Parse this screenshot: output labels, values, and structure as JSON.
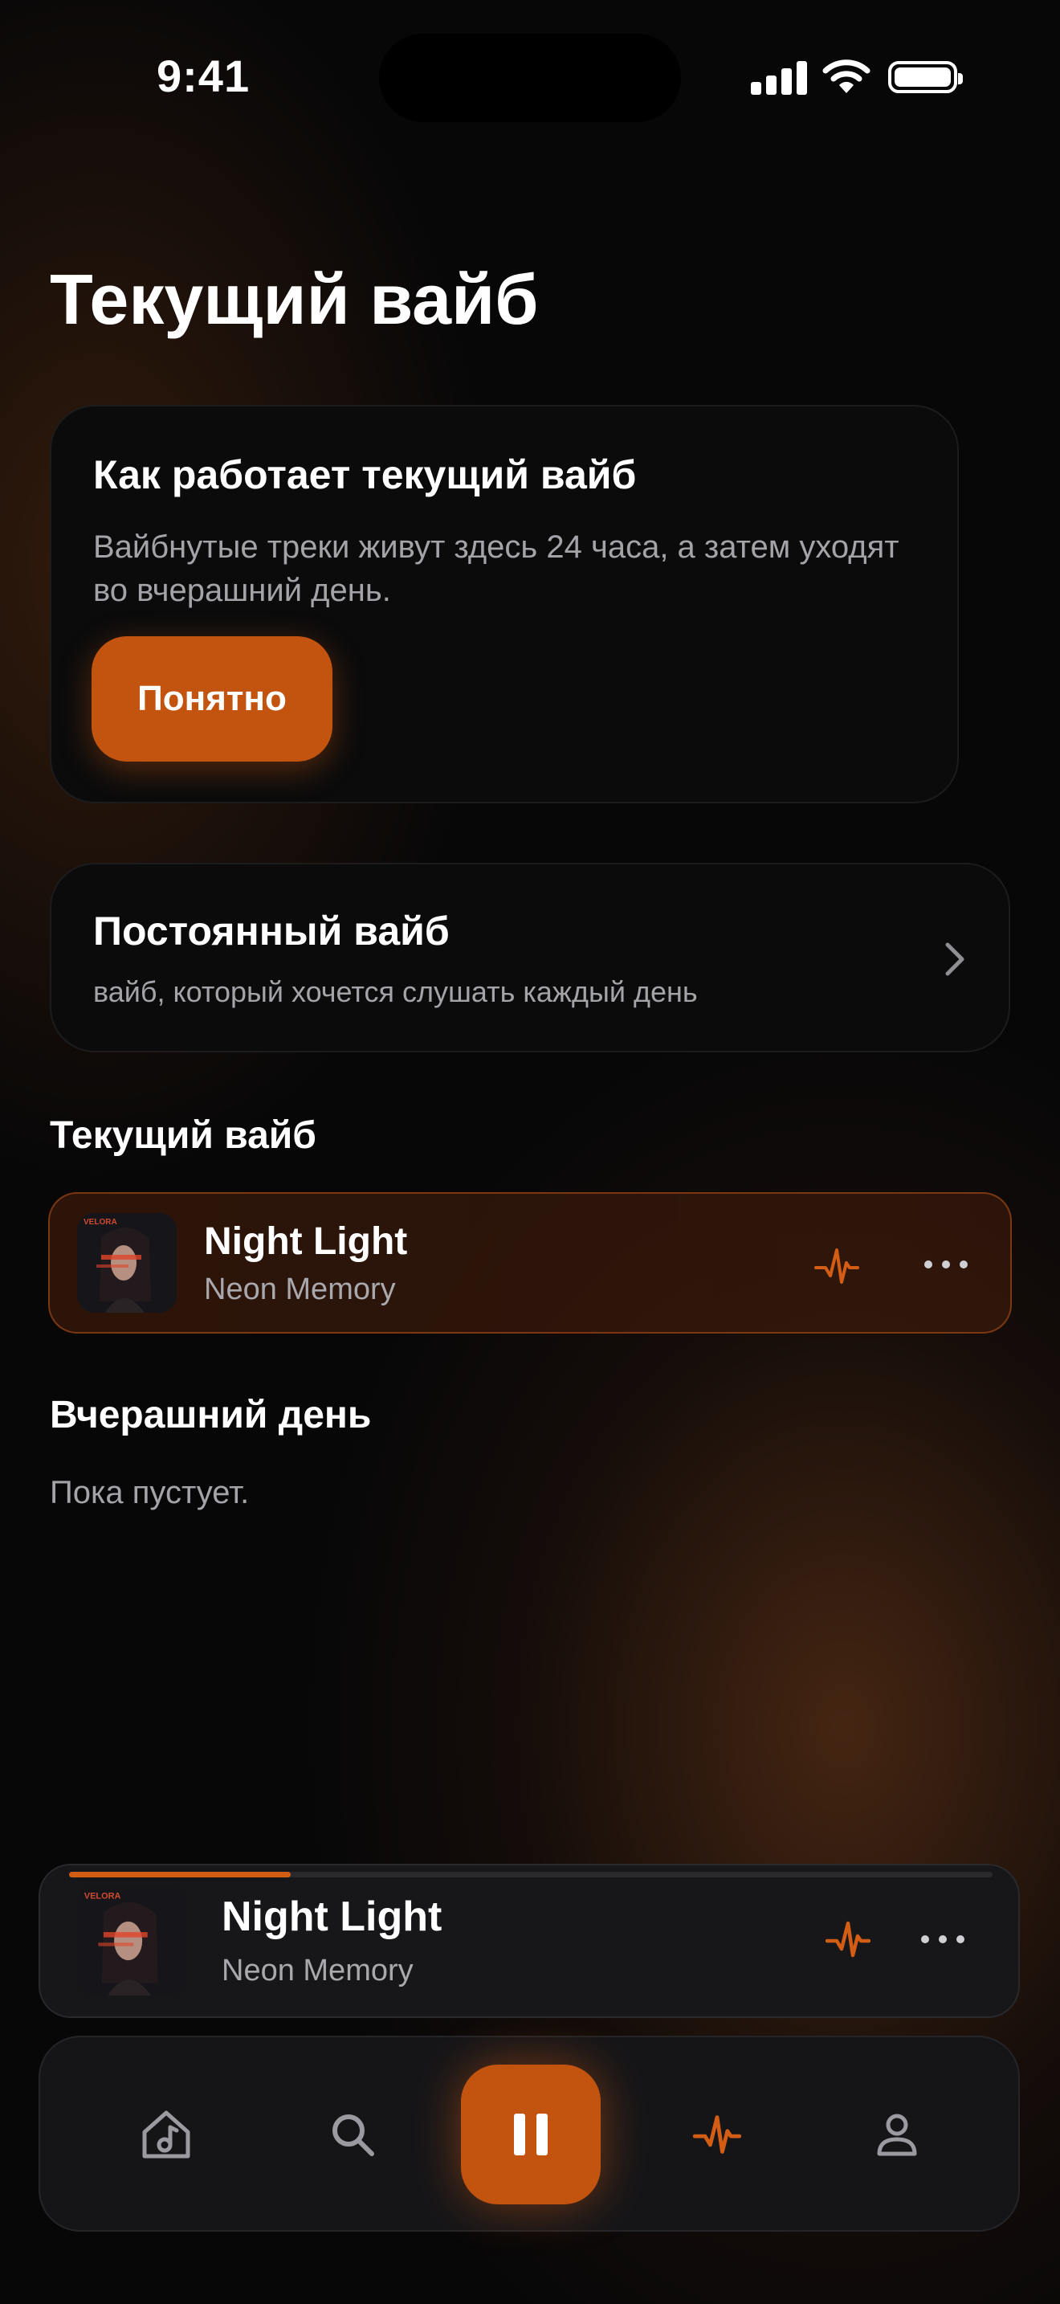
{
  "status_bar": {
    "time": "9:41"
  },
  "page": {
    "title": "Текущий вайб"
  },
  "info_card": {
    "title": "Как работает текущий вайб",
    "text": "Вайбнутые треки живут здесь 24 часа, а затем уходят во вчерашний день.",
    "button_label": "Понятно"
  },
  "permanent_vibe": {
    "title": "Постоянный вайб",
    "subtitle": "вайб, который хочется слушать каждый день"
  },
  "current_section": {
    "heading": "Текущий вайб",
    "tracks": [
      {
        "title": "Night Light",
        "artist": "Neon Memory",
        "cover_text": "VELORA"
      }
    ]
  },
  "yesterday_section": {
    "heading": "Вчерашний день",
    "empty_text": "Пока пустует."
  },
  "mini_player": {
    "title": "Night Light",
    "artist": "Neon Memory",
    "progress": 0.24
  },
  "tab_bar": {
    "tabs": [
      "home-icon",
      "search-icon",
      "pause-icon",
      "pulse-icon",
      "profile-icon"
    ],
    "active": "pulse-icon"
  },
  "colors": {
    "accent": "#c25410",
    "background": "#070708",
    "card": "#0b0b0c"
  }
}
